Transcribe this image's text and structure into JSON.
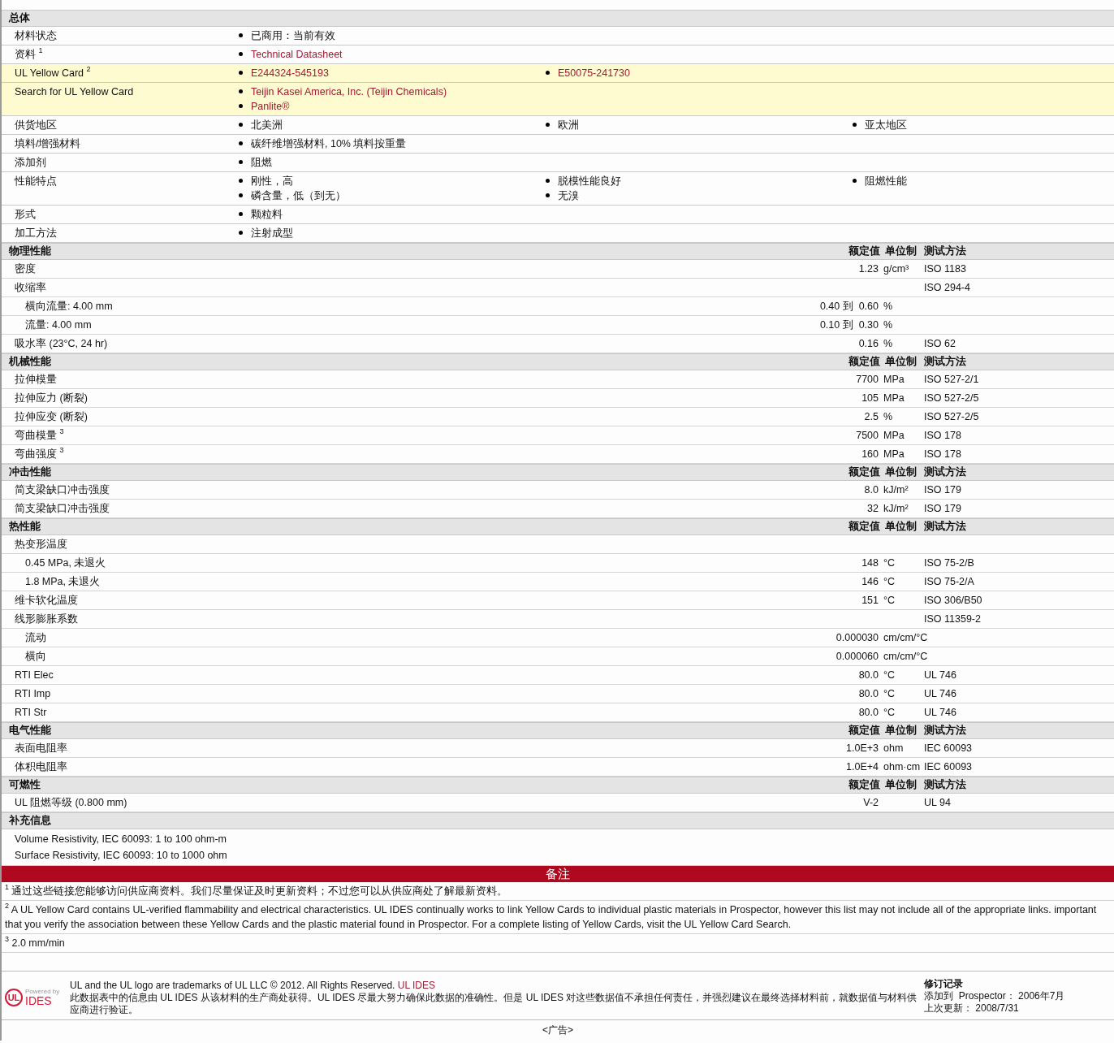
{
  "general": {
    "title": "总体",
    "rows": [
      {
        "label": "材料状态",
        "highlighted": false,
        "columns": [
          [
            {
              "text": "已商用：当前有效",
              "link": false
            }
          ]
        ]
      },
      {
        "label": "资料",
        "note": "1",
        "highlighted": false,
        "columns": [
          [
            {
              "text": "Technical Datasheet",
              "link": true
            }
          ]
        ]
      },
      {
        "label": "UL Yellow Card",
        "note": "2",
        "highlighted": true,
        "columns": [
          [
            {
              "text": "E244324-545193",
              "link": true
            }
          ],
          [
            {
              "text": "E50075-241730",
              "link": true
            }
          ]
        ]
      },
      {
        "label": "Search for UL Yellow Card",
        "highlighted": true,
        "columns": [
          [
            {
              "text": "Teijin Kasei America, Inc. (Teijin Chemicals)",
              "link": true
            },
            {
              "text": "Panlite®",
              "link": true
            }
          ]
        ]
      },
      {
        "label": "供货地区",
        "highlighted": false,
        "columns": [
          [
            {
              "text": "北美洲",
              "link": false
            }
          ],
          [
            {
              "text": "欧洲",
              "link": false
            }
          ],
          [
            {
              "text": "亚太地区",
              "link": false
            }
          ]
        ]
      },
      {
        "label": "填料/增强材料",
        "highlighted": false,
        "columns": [
          [
            {
              "text": "碳纤维增强材料, 10% 填料按重量",
              "link": false
            }
          ]
        ]
      },
      {
        "label": "添加剂",
        "highlighted": false,
        "columns": [
          [
            {
              "text": "阻燃",
              "link": false
            }
          ]
        ]
      },
      {
        "label": "性能特点",
        "highlighted": false,
        "columns": [
          [
            {
              "text": "刚性，高",
              "link": false
            },
            {
              "text": "磷含量，低（到无）",
              "link": false
            }
          ],
          [
            {
              "text": "脱模性能良好",
              "link": false
            },
            {
              "text": "无溴",
              "link": false
            }
          ],
          [
            {
              "text": "阻燃性能",
              "link": false
            }
          ]
        ]
      },
      {
        "label": "形式",
        "highlighted": false,
        "columns": [
          [
            {
              "text": "颗粒料",
              "link": false
            }
          ]
        ]
      },
      {
        "label": "加工方法",
        "highlighted": false,
        "columns": [
          [
            {
              "text": "注射成型",
              "link": false
            }
          ]
        ]
      }
    ]
  },
  "property_sections": [
    {
      "title": "物理性能",
      "value_header": "额定值",
      "unit_header": "单位制",
      "method_header": "测试方法",
      "rows": [
        {
          "label": "密度",
          "value": "1.23",
          "unit": "g/cm³",
          "method": "ISO 1183"
        },
        {
          "label": "收缩率",
          "method": "ISO 294-4",
          "children": [
            {
              "label": "横向流量: 4.00 mm",
              "value": "0.40 到  0.60",
              "unit": "%"
            },
            {
              "label": "流量: 4.00 mm",
              "value": "0.10 到  0.30",
              "unit": "%"
            }
          ]
        },
        {
          "label": "吸水率 (23°C, 24 hr)",
          "value": "0.16",
          "unit": "%",
          "method": "ISO 62"
        }
      ]
    },
    {
      "title": "机械性能",
      "value_header": "额定值",
      "unit_header": "单位制",
      "method_header": "测试方法",
      "rows": [
        {
          "label": "拉伸模量",
          "value": "7700",
          "unit": "MPa",
          "method": "ISO 527-2/1"
        },
        {
          "label": "拉伸应力 (断裂)",
          "value": "105",
          "unit": "MPa",
          "method": "ISO 527-2/5"
        },
        {
          "label": "拉伸应变 (断裂)",
          "value": "2.5",
          "unit": "%",
          "method": "ISO 527-2/5"
        },
        {
          "label": "弯曲模量",
          "note": "3",
          "value": "7500",
          "unit": "MPa",
          "method": "ISO 178"
        },
        {
          "label": "弯曲强度",
          "note": "3",
          "value": "160",
          "unit": "MPa",
          "method": "ISO 178"
        }
      ]
    },
    {
      "title": "冲击性能",
      "value_header": "额定值",
      "unit_header": "单位制",
      "method_header": "测试方法",
      "rows": [
        {
          "label": "简支梁缺口冲击强度",
          "value": "8.0",
          "unit": "kJ/m²",
          "method": "ISO 179"
        },
        {
          "label": "简支梁缺口冲击强度",
          "value": "32",
          "unit": "kJ/m²",
          "method": "ISO 179"
        }
      ]
    },
    {
      "title": "热性能",
      "value_header": "额定值",
      "unit_header": "单位制",
      "method_header": "测试方法",
      "rows": [
        {
          "label": "热变形温度",
          "children": [
            {
              "label": "0.45 MPa, 未退火",
              "value": "148",
              "unit": "°C",
              "method": "ISO 75-2/B"
            },
            {
              "label": "1.8 MPa, 未退火",
              "value": "146",
              "unit": "°C",
              "method": "ISO 75-2/A"
            }
          ]
        },
        {
          "label": "维卡软化温度",
          "value": "151",
          "unit": "°C",
          "method": "ISO 306/B50"
        },
        {
          "label": "线形膨胀系数",
          "method": "ISO 11359-2",
          "children": [
            {
              "label": "流动",
              "value": "0.000030",
              "unit": "cm/cm/°C"
            },
            {
              "label": "横向",
              "value": "0.000060",
              "unit": "cm/cm/°C"
            }
          ]
        },
        {
          "label": "RTI Elec",
          "value": "80.0",
          "unit": "°C",
          "method": "UL 746"
        },
        {
          "label": "RTI Imp",
          "value": "80.0",
          "unit": "°C",
          "method": "UL 746"
        },
        {
          "label": "RTI Str",
          "value": "80.0",
          "unit": "°C",
          "method": "UL 746"
        }
      ]
    },
    {
      "title": "电气性能",
      "value_header": "额定值",
      "unit_header": "单位制",
      "method_header": "测试方法",
      "rows": [
        {
          "label": "表面电阻率",
          "value": "1.0E+3",
          "unit": "ohm",
          "method": "IEC 60093"
        },
        {
          "label": "体积电阻率",
          "value": "1.0E+4",
          "unit": "ohm·cm",
          "method": "IEC 60093"
        }
      ]
    },
    {
      "title": "可燃性",
      "value_header": "额定值",
      "unit_header": "单位制",
      "method_header": "测试方法",
      "rows": [
        {
          "label": "UL 阻燃等级 (0.800 mm)",
          "value": "V-2",
          "method": "UL 94"
        }
      ]
    }
  ],
  "supplementary": {
    "title": "补充信息",
    "lines": [
      "Volume Resistivity, IEC 60093: 1 to 100 ohm-m",
      "Surface Resistivity, IEC 60093: 10 to 1000 ohm"
    ]
  },
  "notes": {
    "title": "备注",
    "footnotes": [
      {
        "mark": "1",
        "text": "通过这些链接您能够访问供应商资料。我们尽量保证及时更新资料；不过您可以从供应商处了解最新资料。"
      },
      {
        "mark": "2",
        "text": "A UL Yellow Card contains UL-verified flammability and electrical characteristics. UL IDES continually works to link Yellow Cards to individual plastic materials in Prospector, however this list may not include all of the appropriate links. important that you verify the association between these Yellow Cards and the plastic material found in Prospector. For a complete listing of Yellow Cards, visit the UL Yellow Card Search."
      },
      {
        "mark": "3",
        "text": "2.0 mm/min"
      }
    ]
  },
  "footer": {
    "logo": {
      "mark": "UL",
      "powered_by": "Powered by",
      "brand": "IDES"
    },
    "trademark": "UL and the UL logo are trademarks of UL LLC © 2012. All Rights Reserved.",
    "link": "UL IDES",
    "disclaimer": "此数据表中的信息由  UL IDES 从该材料的生产商处获得。UL IDES 尽最大努力确保此数据的准确性。但是  UL IDES 对这些数据值不承担任何责任，并强烈建议在最终选择材料前，就数据值与材料供应商进行验证。",
    "revision": {
      "title": "修订记录",
      "entries": [
        {
          "label": "添加到  Prospector：",
          "value": "2006年7月"
        },
        {
          "label": "上次更新：",
          "value": "2008/7/31"
        }
      ]
    },
    "ad": "<广告>"
  }
}
